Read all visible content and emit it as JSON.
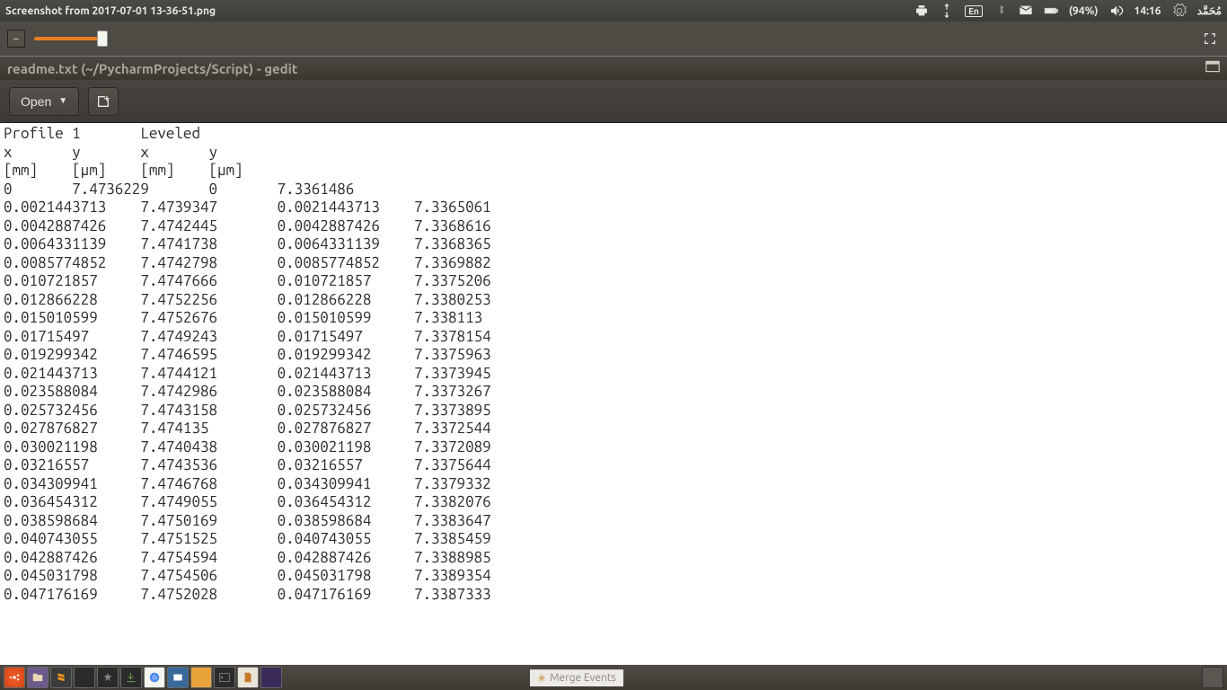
{
  "top_panel": {
    "title": "Screenshot from 2017-07-01 13-36-51.png",
    "lang": "En",
    "battery": "(94%)",
    "time": "14:16",
    "username": "مُحَمَّد"
  },
  "gedit": {
    "title": "readme.txt (~/PycharmProjects/Script) - gedit",
    "open_label": "Open"
  },
  "editor": {
    "header1": "Profile 1       Leveled",
    "header2": "x       y       x       y",
    "header3": "[mm]    [µm]    [mm]    [µm]",
    "rows": [
      [
        "0",
        "7.4736229",
        "0",
        "7.3361486"
      ],
      [
        "0.0021443713",
        "7.4739347",
        "0.0021443713",
        "7.3365061"
      ],
      [
        "0.0042887426",
        "7.4742445",
        "0.0042887426",
        "7.3368616"
      ],
      [
        "0.0064331139",
        "7.4741738",
        "0.0064331139",
        "7.3368365"
      ],
      [
        "0.0085774852",
        "7.4742798",
        "0.0085774852",
        "7.3369882"
      ],
      [
        "0.010721857",
        "7.4747666",
        "0.010721857",
        "7.3375206"
      ],
      [
        "0.012866228",
        "7.4752256",
        "0.012866228",
        "7.3380253"
      ],
      [
        "0.015010599",
        "7.4752676",
        "0.015010599",
        "7.338113"
      ],
      [
        "0.01715497",
        "7.4749243",
        "0.01715497",
        "7.3378154"
      ],
      [
        "0.019299342",
        "7.4746595",
        "0.019299342",
        "7.3375963"
      ],
      [
        "0.021443713",
        "7.4744121",
        "0.021443713",
        "7.3373945"
      ],
      [
        "0.023588084",
        "7.4742986",
        "0.023588084",
        "7.3373267"
      ],
      [
        "0.025732456",
        "7.4743158",
        "0.025732456",
        "7.3373895"
      ],
      [
        "0.027876827",
        "7.474135",
        "0.027876827",
        "7.3372544"
      ],
      [
        "0.030021198",
        "7.4740438",
        "0.030021198",
        "7.3372089"
      ],
      [
        "0.03216557",
        "7.4743536",
        "0.03216557",
        "7.3375644"
      ],
      [
        "0.034309941",
        "7.4746768",
        "0.034309941",
        "7.3379332"
      ],
      [
        "0.036454312",
        "7.4749055",
        "0.036454312",
        "7.3382076"
      ],
      [
        "0.038598684",
        "7.4750169",
        "0.038598684",
        "7.3383647"
      ],
      [
        "0.040743055",
        "7.4751525",
        "0.040743055",
        "7.3385459"
      ],
      [
        "0.042887426",
        "7.4754594",
        "0.042887426",
        "7.3388985"
      ],
      [
        "0.045031798",
        "7.4754506",
        "0.045031798",
        "7.3389354"
      ],
      [
        "0.047176169",
        "7.4752028",
        "0.047176169",
        "7.3387333"
      ]
    ]
  },
  "bottom": {
    "merge": "Merge Events"
  }
}
